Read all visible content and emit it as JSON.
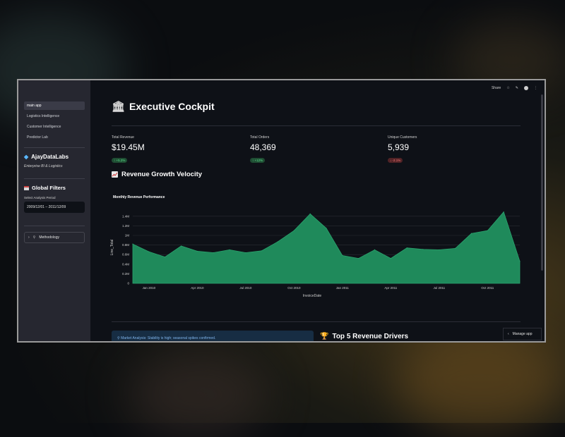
{
  "sidebar": {
    "nav": [
      "main app",
      "Logistics Intelligence",
      "Customer Intelligence",
      "Predictor Lab"
    ],
    "brand": "AjayDataLabs",
    "brand_subtitle": "Enterprise BI & Logistics",
    "filters_heading": "Global Filters",
    "period_label": "Select Analysis Period",
    "period_value": "2009/12/01 – 2011/12/09",
    "methodology": "Methodology"
  },
  "topbar": {
    "share": "Share"
  },
  "header": {
    "title": "Executive Cockpit"
  },
  "metrics": [
    {
      "label": "Total Revenue",
      "value": "$19.45M",
      "delta": "+5.2%",
      "direction": "up"
    },
    {
      "label": "Total Orders",
      "value": "48,369",
      "delta": "+12%",
      "direction": "up"
    },
    {
      "label": "Unique Customers",
      "value": "5,939",
      "delta": "-2.1%",
      "direction": "down"
    }
  ],
  "section": {
    "title": "Revenue Growth Velocity"
  },
  "chart_data": {
    "type": "area",
    "title": "Monthly Revenue Performance",
    "xlabel": "InvoiceDate",
    "ylabel": "Line_Total",
    "x_ticks": [
      "Jan 2010",
      "Apr 2010",
      "Jul 2010",
      "Oct 2010",
      "Jan 2011",
      "Apr 2011",
      "Jul 2011",
      "Oct 2011"
    ],
    "y_ticks": [
      "0",
      "0.2M",
      "0.4M",
      "0.6M",
      "0.8M",
      "1M",
      "1.2M",
      "1.4M"
    ],
    "ylim": [
      0,
      1.5
    ],
    "grid": true,
    "color": "#1f8a5b",
    "points": [
      {
        "x": "2009-12",
        "y": 0.82
      },
      {
        "x": "2010-01",
        "y": 0.66
      },
      {
        "x": "2010-02",
        "y": 0.55
      },
      {
        "x": "2010-03",
        "y": 0.78
      },
      {
        "x": "2010-04",
        "y": 0.67
      },
      {
        "x": "2010-05",
        "y": 0.64
      },
      {
        "x": "2010-06",
        "y": 0.7
      },
      {
        "x": "2010-07",
        "y": 0.64
      },
      {
        "x": "2010-08",
        "y": 0.68
      },
      {
        "x": "2010-09",
        "y": 0.87
      },
      {
        "x": "2010-10",
        "y": 1.1
      },
      {
        "x": "2010-11",
        "y": 1.45
      },
      {
        "x": "2010-12",
        "y": 1.15
      },
      {
        "x": "2011-01",
        "y": 0.58
      },
      {
        "x": "2011-02",
        "y": 0.52
      },
      {
        "x": "2011-03",
        "y": 0.7
      },
      {
        "x": "2011-04",
        "y": 0.52
      },
      {
        "x": "2011-05",
        "y": 0.74
      },
      {
        "x": "2011-06",
        "y": 0.71
      },
      {
        "x": "2011-07",
        "y": 0.7
      },
      {
        "x": "2011-08",
        "y": 0.73
      },
      {
        "x": "2011-09",
        "y": 1.04
      },
      {
        "x": "2011-10",
        "y": 1.1
      },
      {
        "x": "2011-11",
        "y": 1.49
      },
      {
        "x": "2011-12",
        "y": 0.46
      }
    ]
  },
  "info": {
    "text": "Market Analysis: Stability is high; seasonal spikes confirmed."
  },
  "drivers": {
    "title": "Top 5 Revenue Drivers"
  },
  "manage": {
    "label": "Manage app"
  },
  "colors": {
    "accent": "#1f8a5b",
    "bg": "#0e1117",
    "sidebar": "#262730"
  }
}
